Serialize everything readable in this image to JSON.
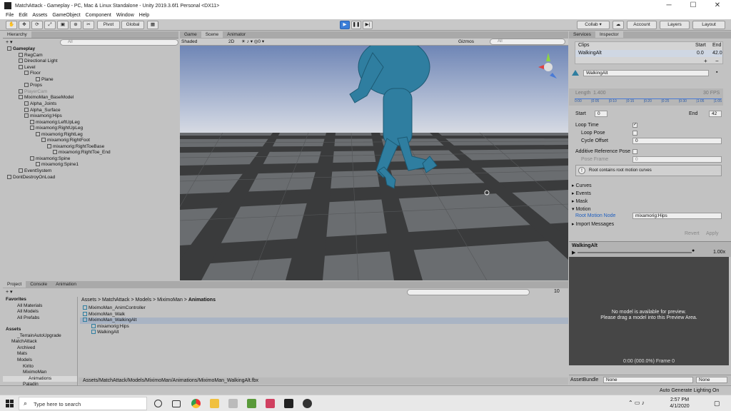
{
  "window": {
    "title": "MatchAttack - Gameplay - PC, Mac & Linux Standalone - Unity 2019.3.6f1 Personal <DX11>",
    "minimize": "─",
    "maximize": "☐",
    "close": "✕"
  },
  "menu": [
    "File",
    "Edit",
    "Assets",
    "GameObject",
    "Component",
    "Window",
    "Help"
  ],
  "toolbar": {
    "pivot": "Pivot",
    "global": "Global",
    "collab": "Collab ▾",
    "account": "Account",
    "layers": "Layers",
    "layout": "Layout"
  },
  "hierarchy": {
    "tab": "Hierarchy",
    "search_placeholder": "All",
    "items": [
      {
        "label": "Gameplay",
        "indent": 0,
        "bold": true
      },
      {
        "label": "RegCam",
        "indent": 2
      },
      {
        "label": "Directional Light",
        "indent": 2
      },
      {
        "label": "Level",
        "indent": 2
      },
      {
        "label": "Floor",
        "indent": 3
      },
      {
        "label": "Plane",
        "indent": 5
      },
      {
        "label": "Props",
        "indent": 3
      },
      {
        "label": "PlayerCam",
        "indent": 2,
        "dim": true
      },
      {
        "label": "MiximoMan_BaseModel",
        "indent": 2
      },
      {
        "label": "Alpha_Joints",
        "indent": 3
      },
      {
        "label": "Alpha_Surface",
        "indent": 3
      },
      {
        "label": "mixamorig:Hips",
        "indent": 3
      },
      {
        "label": "mixamorig:LeftUpLeg",
        "indent": 4
      },
      {
        "label": "mixamorig:RightUpLeg",
        "indent": 4
      },
      {
        "label": "mixamorig:RightLeg",
        "indent": 5
      },
      {
        "label": "mixamorig:RightFoot",
        "indent": 6
      },
      {
        "label": "mixamorig:RightToeBase",
        "indent": 7
      },
      {
        "label": "mixamorig:RightToe_End",
        "indent": 8
      },
      {
        "label": "mixamorig:Spine",
        "indent": 4
      },
      {
        "label": "mixamorig:Spine1",
        "indent": 5
      },
      {
        "label": "EventSystem",
        "indent": 2
      },
      {
        "label": "DontDestroyOnLoad",
        "indent": 0
      }
    ]
  },
  "scene": {
    "tabs": [
      "Game",
      "Scene",
      "Animator"
    ],
    "shading": "Shaded",
    "mode": "2D",
    "gizmos": "Gizmos",
    "search_placeholder": "All"
  },
  "inspector": {
    "tabs": [
      "Services",
      "Inspector"
    ],
    "clips": {
      "header": "Clips",
      "start_label": "Start",
      "end_label": "End",
      "name": "WalkingAlt",
      "start": "0.0",
      "end": "42.0"
    },
    "clip_name": "WalkingAlt",
    "length_label": "Length",
    "length": "1.400",
    "fps": "30 FPS",
    "ticks": [
      "0:00",
      "|0:05",
      "|0:10",
      "|0:15",
      "|0:20",
      "|0:25",
      "|0:30",
      "|1:05",
      "|1:05"
    ],
    "start_label": "Start",
    "start": "0",
    "end_label": "End",
    "end": "42",
    "loop_time": "Loop Time",
    "loop_pose": "Loop Pose",
    "cycle_offset": "Cycle Offset",
    "cycle_offset_value": "0",
    "additive": "Additive Reference Pose",
    "pose_frame": "Pose Frame",
    "pose_frame_value": "0",
    "info": "Root contains root motion curves",
    "sections": [
      "Curves",
      "Events",
      "Mask",
      "Motion"
    ],
    "root_motion_label": "Root Motion Node",
    "root_motion_value": "mixamorig:Hips",
    "import_messages": "Import Messages",
    "revert": "Revert",
    "apply": "Apply",
    "preview_title": "WalkingAlt",
    "speed": "1.00x",
    "preview_msg1": "No model is available for preview.",
    "preview_msg2": "Please drag a model into this Preview Area.",
    "preview_time": "0:00 (000.0%) Frame 0",
    "assetbundle_label": "AssetBundle",
    "assetbundle_value": "None",
    "variant_value": "None"
  },
  "project": {
    "tabs": [
      "Project",
      "Console",
      "Animation"
    ],
    "count": "10",
    "favorites": [
      "Favorites",
      "All Materials",
      "All Models",
      "All Prefabs"
    ],
    "assets_tree": [
      "Assets",
      "_TerrainAutoUpgrade",
      "MatchAttack",
      "Archived",
      "Mats",
      "Models",
      "Kirito",
      "MiximoMan",
      "Animations",
      "Paladin"
    ],
    "breadcrumb": [
      "Assets",
      "MatchAttack",
      "Models",
      "MiximoMan",
      "Animations"
    ],
    "files": [
      "MiximoMan_AnimController",
      "MiximoMan_Walk",
      "MiximoMan_WalkingAlt",
      "mixamorig:Hips",
      "WalkingAlt"
    ],
    "path": "Assets/MatchAttack/Models/MiximoMan/Animations/MiximoMan_WalkingAlt.fbx"
  },
  "status": {
    "text": "Auto Generate Lighting On"
  },
  "taskbar": {
    "search": "Type here to search",
    "time": "2:57 PM",
    "date": "4/1/2020"
  }
}
